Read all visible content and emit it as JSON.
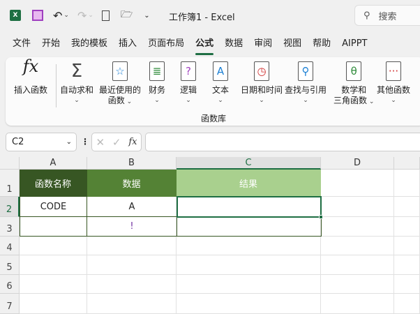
{
  "title": "工作簿1  -  Excel",
  "search_placeholder": "搜索",
  "tabs": [
    "文件",
    "开始",
    "我的模板",
    "插入",
    "页面布局",
    "公式",
    "数据",
    "审阅",
    "视图",
    "帮助",
    "AIPPT"
  ],
  "ribbon": {
    "insert_function": "插入函数",
    "buttons": [
      {
        "l1": "自动求和",
        "l2": "",
        "icon": "Σ",
        "color": "#444"
      },
      {
        "l1": "最近使用的",
        "l2": "函数",
        "icon": "☆",
        "color": "#1a7fd4"
      },
      {
        "l1": "财务",
        "l2": "",
        "icon": "≣",
        "color": "#2e8b3a"
      },
      {
        "l1": "逻辑",
        "l2": "",
        "icon": "?",
        "color": "#a040c0"
      },
      {
        "l1": "文本",
        "l2": "",
        "icon": "A",
        "color": "#1a7fd4"
      },
      {
        "l1": "日期和时间",
        "l2": "",
        "icon": "◷",
        "color": "#d03030"
      },
      {
        "l1": "查找与引用",
        "l2": "",
        "icon": "⚲",
        "color": "#1a7fd4"
      },
      {
        "l1": "数学和",
        "l2": "三角函数",
        "icon": "θ",
        "color": "#2e8b3a"
      },
      {
        "l1": "其他函数",
        "l2": "",
        "icon": "···",
        "color": "#d03030"
      }
    ],
    "group_label": "函数库"
  },
  "name_box": "C2",
  "columns": [
    "A",
    "B",
    "C",
    "D"
  ],
  "rows": [
    "1",
    "2",
    "3",
    "4",
    "5",
    "6",
    "7"
  ],
  "cells": {
    "a1": "函数名称",
    "b1": "数据",
    "c1": "结果",
    "a2": "CODE",
    "b2": "A",
    "b3": "!"
  },
  "colors": {
    "a1": "#375623",
    "b1": "#548235",
    "c1": "#a9d08e",
    "accent": "#1e6e43"
  }
}
